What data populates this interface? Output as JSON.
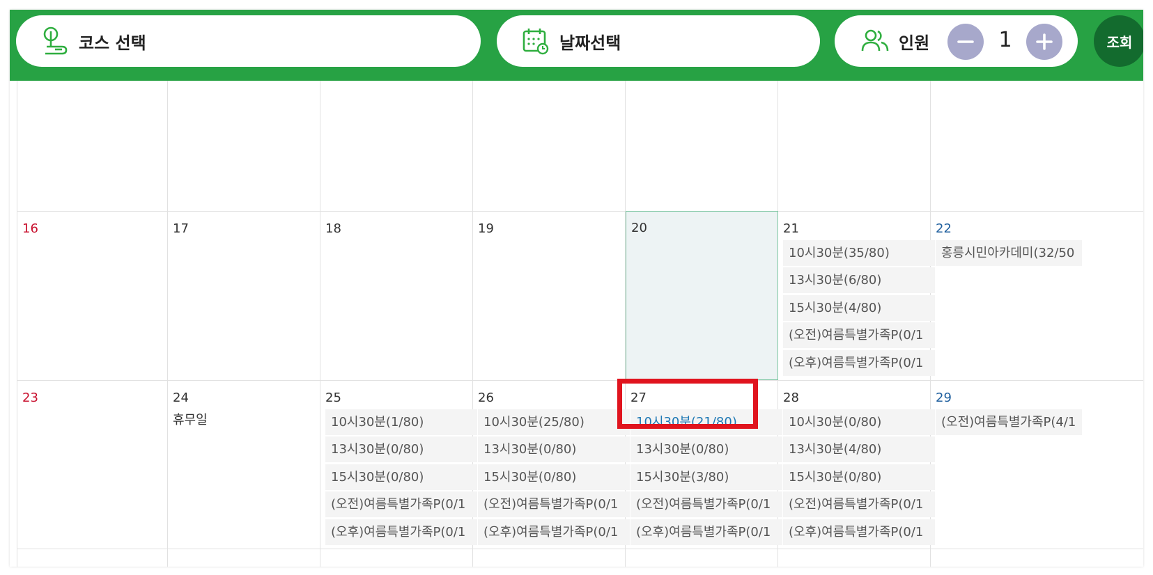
{
  "toolbar": {
    "course_label": "코스 선택",
    "date_label": "날짜선택",
    "people_label": "인원",
    "people_count": "1",
    "search_label": "조회",
    "course_icon": "tree-map-icon",
    "date_icon": "calendar-clock-icon",
    "people_icon": "users-icon"
  },
  "colors": {
    "topbar": "#27a244",
    "search_button": "#136b2e",
    "stepper": "#a7a8cb",
    "sunday": "#c8102e",
    "saturday": "#1f5f9e",
    "selected_link": "#1e78b4",
    "highlight": "#e0141e"
  },
  "calendar": {
    "week2": {
      "d16": "16",
      "d17": "17",
      "d18": "18",
      "d19": "19",
      "d20": "20",
      "d21": "21",
      "d21_slots": [
        "10시30분(35/80)",
        "13시30분(6/80)",
        "15시30분(4/80)",
        "(오전)여름특별가족P(0/1",
        "(오후)여름특별가족P(0/1"
      ],
      "d22": "22",
      "d22_slots": [
        "홍릉시민아카데미(32/50"
      ]
    },
    "week3": {
      "d23": "23",
      "d24": "24",
      "d24_note": "휴무일",
      "d25": "25",
      "d25_slots": [
        "10시30분(1/80)",
        "13시30분(0/80)",
        "15시30분(0/80)",
        "(오전)여름특별가족P(0/1",
        "(오후)여름특별가족P(0/1"
      ],
      "d26": "26",
      "d26_slots": [
        "10시30분(25/80)",
        "13시30분(0/80)",
        "15시30분(0/80)",
        "(오전)여름특별가족P(0/1",
        "(오후)여름특별가족P(0/1"
      ],
      "d27": "27",
      "d27_slots": [
        "10시30분(21/80)",
        "13시30분(0/80)",
        "15시30분(3/80)",
        "(오전)여름특별가족P(0/1",
        "(오후)여름특별가족P(0/1"
      ],
      "d28": "28",
      "d28_slots": [
        "10시30분(0/80)",
        "13시30분(4/80)",
        "15시30분(0/80)",
        "(오전)여름특별가족P(0/1",
        "(오후)여름특별가족P(0/1"
      ],
      "d29": "29",
      "d29_slots": [
        "(오전)여름특별가족P(4/1"
      ]
    }
  }
}
